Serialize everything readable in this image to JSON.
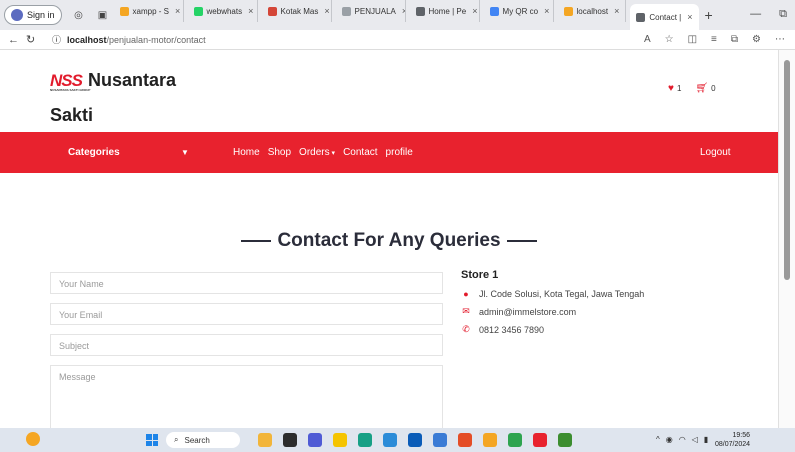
{
  "browser": {
    "signin_label": "Sign in",
    "tabs": [
      {
        "label": "xampp - S",
        "color": "#f4a623"
      },
      {
        "label": "webwhats",
        "color": "#25d366"
      },
      {
        "label": "Kotak Mas",
        "color": "#d44638"
      },
      {
        "label": "PENJUALA",
        "color": "#9aa0a6"
      },
      {
        "label": "Home | Pe",
        "color": "#5f6368"
      },
      {
        "label": "My QR co",
        "color": "#4285f4"
      },
      {
        "label": "localhost",
        "color": "#f4a623"
      },
      {
        "label": "Contact |",
        "color": "#5f6368",
        "active": true
      }
    ],
    "url_host": "localhost",
    "url_path": "/penjualan-motor/contact"
  },
  "site": {
    "logo_text": "NSS",
    "logo_sub": "NUSANTARA SAKTI GROUP",
    "brand_line1": "Nusantara",
    "brand_line2": "Sakti",
    "wishlist_count": "1",
    "cart_count": "0"
  },
  "nav": {
    "categories_label": "Categories",
    "links": [
      "Home",
      "Shop",
      "Orders",
      "Contact",
      "profile"
    ],
    "logout_label": "Logout"
  },
  "contact": {
    "heading": "Contact For Any Queries",
    "placeholders": {
      "name": "Your Name",
      "email": "Your Email",
      "subject": "Subject",
      "message": "Message"
    },
    "store_title": "Store 1",
    "address": "Jl. Code Solusi, Kota Tegal, Jawa Tengah",
    "email": "admin@immelstore.com",
    "phone": "0812 3456 7890"
  },
  "taskbar": {
    "search_label": "Search",
    "time": "19:56",
    "date": "08/07/2024"
  },
  "colors": {
    "accent": "#e8222e",
    "heading": "#2b2d3a"
  }
}
